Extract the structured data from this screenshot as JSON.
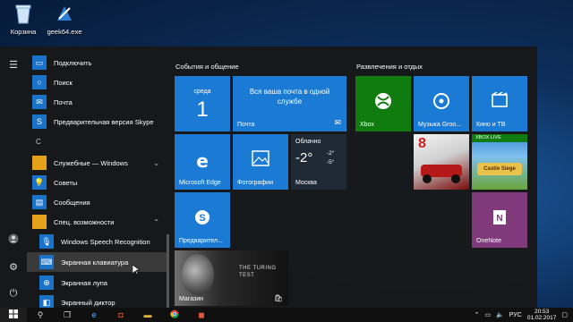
{
  "desktop": {
    "icons": [
      {
        "label": "Корзина",
        "icon": "recycle-bin-icon"
      },
      {
        "label": "geek64.exe",
        "icon": "geek-app-icon"
      }
    ]
  },
  "start_menu": {
    "apps": [
      {
        "label": "Подключить",
        "icon": "connect-icon"
      },
      {
        "label": "Поиск",
        "icon": "search-icon"
      },
      {
        "label": "Почта",
        "icon": "mail-icon"
      },
      {
        "label": "Предварительная версия Skype",
        "icon": "skype-icon"
      },
      {
        "label": "С",
        "type": "letter"
      },
      {
        "label": "Служебные — Windows",
        "icon": "folder-icon",
        "expandable": true
      },
      {
        "label": "Советы",
        "icon": "tips-icon"
      },
      {
        "label": "Сообщения",
        "icon": "messages-icon"
      },
      {
        "label": "Спец. возможности",
        "icon": "folder-icon",
        "expandable": true,
        "expanded": true
      },
      {
        "label": "Windows Speech Recognition",
        "icon": "microphone-icon"
      },
      {
        "label": "Экранная клавиатура",
        "icon": "keyboard-icon"
      },
      {
        "label": "Экранная лупа",
        "icon": "magnifier-icon"
      },
      {
        "label": "Экранный диктор",
        "icon": "narrator-icon"
      }
    ],
    "groups": [
      {
        "title": "События и общение"
      },
      {
        "title": "Развлечения и отдых"
      }
    ],
    "tiles": {
      "calendar": {
        "day_name": "среда",
        "day_num": "1"
      },
      "mail": {
        "text": "Вся ваша почта в одной службе",
        "label": "Почта"
      },
      "edge": {
        "label": "Microsoft Edge"
      },
      "photos": {
        "label": "Фотографии"
      },
      "weather": {
        "condition": "Облачно",
        "temp": "-2°",
        "hi": "-2°",
        "lo": "-5°",
        "city": "Москва"
      },
      "skype": {
        "label": "Предварител..."
      },
      "store": {
        "label": "Магазин",
        "promo_title": "THE TURING TEST"
      },
      "xbox": {
        "label": "Xbox"
      },
      "music": {
        "label": "Музыка Groo..."
      },
      "movies": {
        "label": "Кино и ТВ"
      },
      "racing": {
        "label": "8"
      },
      "castle": {
        "badge": "XBOX LIVE",
        "title": "Castle Siege"
      },
      "onenote": {
        "label": "OneNote"
      }
    }
  },
  "taskbar": {
    "lang": "РУС",
    "time": "20:53",
    "date": "01.02.2017"
  },
  "colors": {
    "accent": "#1a7ad4",
    "onenote": "#80397b"
  }
}
